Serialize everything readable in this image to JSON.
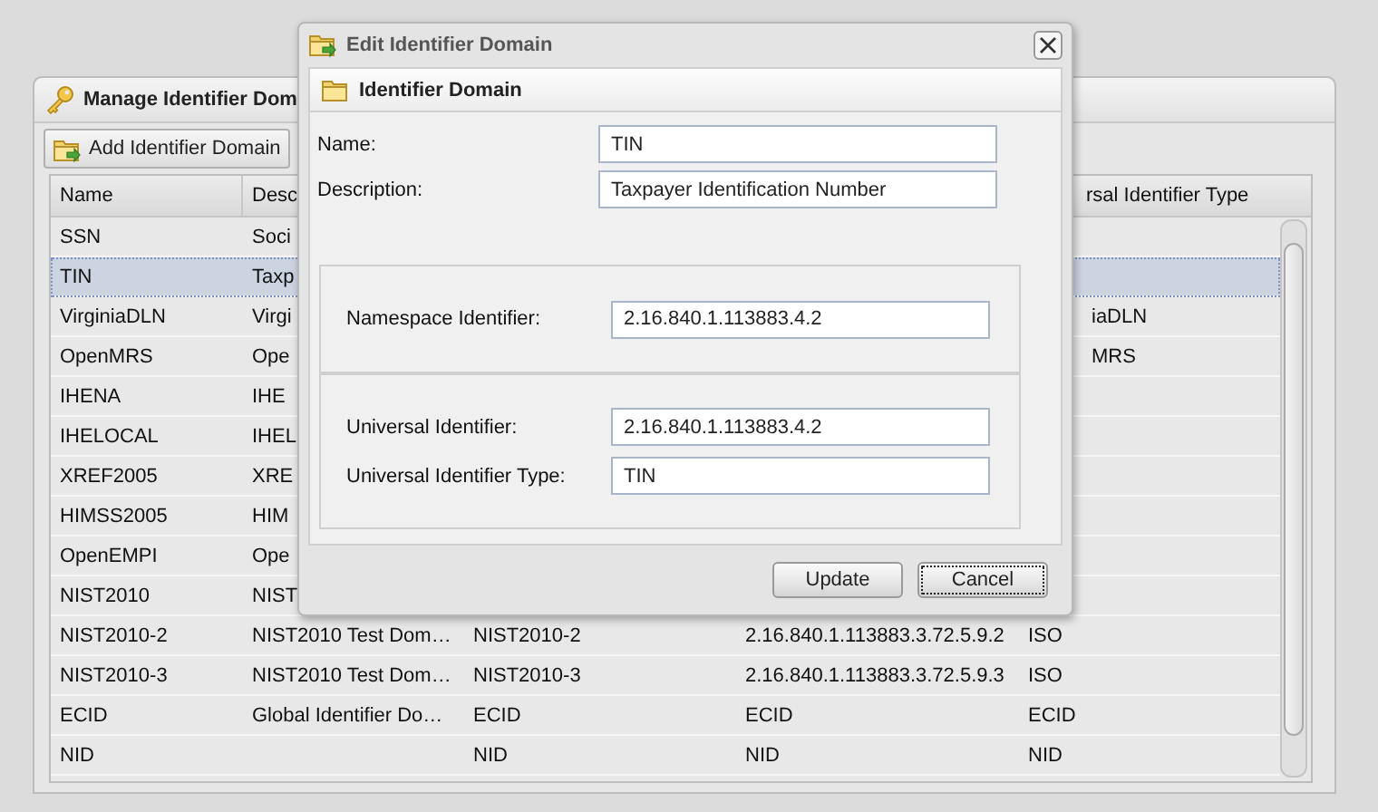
{
  "background_window": {
    "title": "Manage Identifier Dom",
    "toolbar": [
      {
        "label": "Add Identifier Domain"
      }
    ],
    "table": {
      "columns": {
        "name": "Name",
        "description": "Desc",
        "column_5": "rsal Identifier Type"
      },
      "rows": [
        {
          "kind": "partly_hidden",
          "selected": false,
          "name": "SSN",
          "description": "Soci"
        },
        {
          "kind": "partly_hidden",
          "selected": true,
          "name": "TIN",
          "description": "Taxp"
        },
        {
          "kind": "partly_hidden",
          "selected": false,
          "name": "VirginiaDLN",
          "description": "Virgi",
          "column_5": "iaDLN"
        },
        {
          "kind": "partly_hidden",
          "selected": false,
          "name": "OpenMRS",
          "description": "Ope",
          "column_5": "MRS"
        },
        {
          "kind": "partly_hidden",
          "selected": false,
          "name": "IHENA",
          "description": "IHE"
        },
        {
          "kind": "partly_hidden",
          "selected": false,
          "name": "IHELOCAL",
          "description": "IHEL"
        },
        {
          "kind": "partly_hidden",
          "selected": false,
          "name": "XREF2005",
          "description": "XRE"
        },
        {
          "kind": "partly_hidden",
          "selected": false,
          "name": "HIMSS2005",
          "description": "HIM"
        },
        {
          "kind": "partly_hidden",
          "selected": false,
          "name": "OpenEMPI",
          "description": "Ope"
        },
        {
          "kind": "partly_hidden",
          "selected": false,
          "name": "NIST2010",
          "description": "NIST"
        },
        {
          "kind": "full",
          "selected": false,
          "name": "NIST2010-2",
          "description": "NIST2010 Test Dom…",
          "column_3": "NIST2010-2",
          "column_4": "2.16.840.1.113883.3.72.5.9.2",
          "column_5": "ISO"
        },
        {
          "kind": "full",
          "selected": false,
          "name": "NIST2010-3",
          "description": "NIST2010 Test Dom…",
          "column_3": "NIST2010-3",
          "column_4": "2.16.840.1.113883.3.72.5.9.3",
          "column_5": "ISO"
        },
        {
          "kind": "full",
          "selected": false,
          "name": "ECID",
          "description": "Global Identifier Do…",
          "column_3": "ECID",
          "column_4": "ECID",
          "column_5": "ECID"
        },
        {
          "kind": "full",
          "selected": false,
          "name": "NID",
          "column_3": "NID",
          "column_4": "NID",
          "column_5": "NID"
        }
      ]
    }
  },
  "dialog": {
    "title": "Edit Identifier Domain",
    "panel_title": "Identifier Domain",
    "fields": [
      {
        "label": "Name:",
        "value": "TIN"
      },
      {
        "label": "Description:",
        "value": "Taxpayer Identification Number"
      }
    ],
    "groups": [
      {
        "fields": [
          {
            "label": "Namespace Identifier:",
            "value": "2.16.840.1.113883.4.2"
          }
        ]
      },
      {
        "fields": [
          {
            "label": "Universal Identifier:",
            "value": "2.16.840.1.113883.4.2"
          },
          {
            "label": "Universal Identifier Type:",
            "value": "TIN"
          }
        ]
      }
    ],
    "buttons": [
      {
        "label": "Update",
        "focused": false
      },
      {
        "label": "Cancel",
        "focused": true
      }
    ]
  }
}
